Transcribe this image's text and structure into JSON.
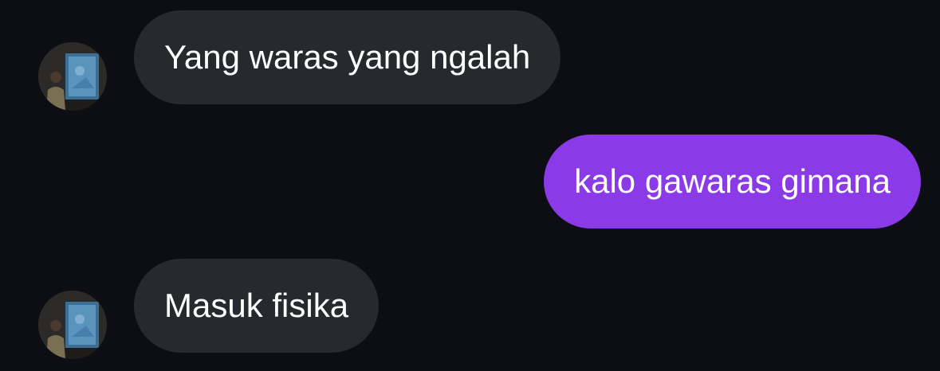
{
  "colors": {
    "background": "#0c0e13",
    "incoming_bubble": "#26292e",
    "outgoing_bubble": "#8a3ae6",
    "text": "#ffffff"
  },
  "messages": [
    {
      "direction": "incoming",
      "text": "Yang waras yang ngalah",
      "avatar": "contact-avatar"
    },
    {
      "direction": "outgoing",
      "text": "kalo gawaras gimana"
    },
    {
      "direction": "incoming",
      "text": "Masuk fisika",
      "avatar": "contact-avatar"
    }
  ]
}
